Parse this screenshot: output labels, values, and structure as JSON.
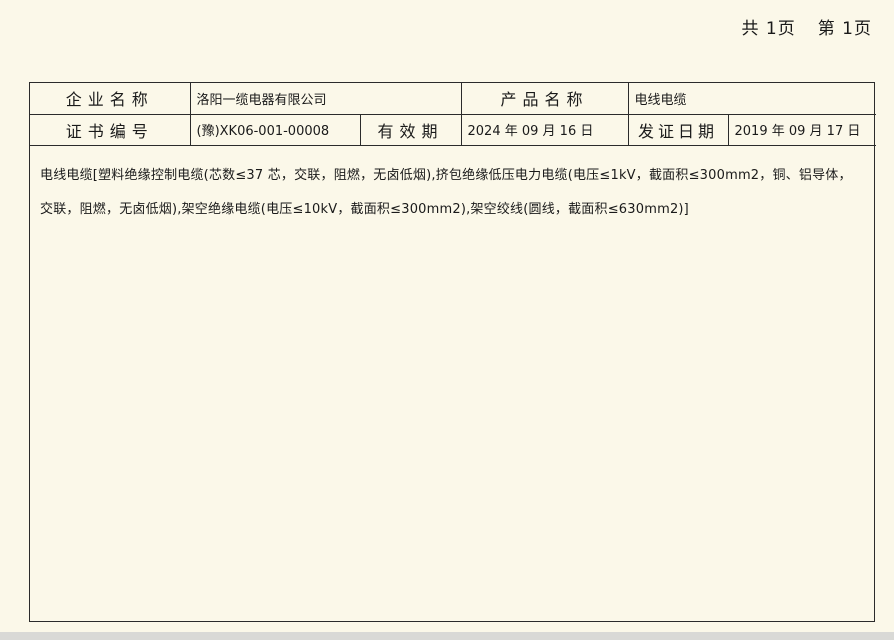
{
  "pagination": {
    "total": "共 1页",
    "current": "第 1页"
  },
  "cert": {
    "company_label": "企业名称",
    "company_value": "洛阳一缆电器有限公司",
    "product_label": "产品名称",
    "product_value": "电线电缆",
    "cert_no_label": "证书编号",
    "cert_no_value": "(豫)XK06-001-00008",
    "validity_label": "有效期",
    "validity_value": "2024 年 09 月 16 日",
    "issue_date_label": "发证日期",
    "issue_date_value": "2019 年 09 月 17 日",
    "scope_text": "电线电缆[塑料绝缘控制电缆(芯数≤37 芯，交联，阻燃，无卤低烟),挤包绝缘低压电力电缆(电压≤1kV，截面积≤300mm2，铜、铝导体，交联，阻燃，无卤低烟),架空绝缘电缆(电压≤10kV，截面积≤300mm2),架空绞线(圆线，截面积≤630mm2)]"
  }
}
